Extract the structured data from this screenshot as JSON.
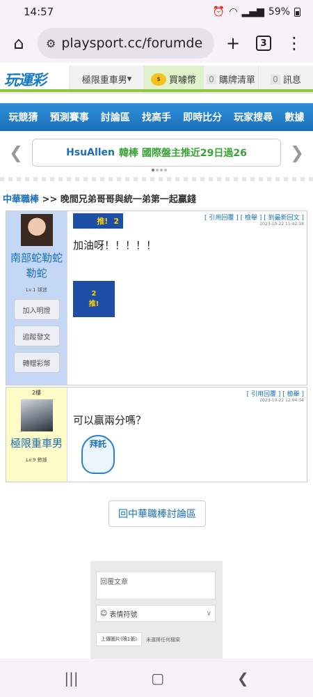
{
  "status": {
    "time": "14:57",
    "battery": "59%"
  },
  "browser": {
    "url": "playsport.cc/forumde",
    "tab_count": "3"
  },
  "site": {
    "logo": "玩運彩",
    "user": "極限重車男",
    "coins_label": "買噱幣",
    "watchlist": {
      "count": "0",
      "label": "購牌清單"
    },
    "messages": {
      "count": "0",
      "label": "訊息"
    }
  },
  "nav": [
    "玩競猜",
    "預測賽事",
    "討論區",
    "找高手",
    "即時比分",
    "玩家搜尋",
    "數據"
  ],
  "marquee": {
    "author": "HsuAllen",
    "text": "韓棒 國際盤主推近29日過26"
  },
  "breadcrumb": {
    "forum": "中華職棒",
    "sep": ">>",
    "title": "晚間兄弟哥哥與統一弟第一起贏錢"
  },
  "posts": [
    {
      "author": "南部蛇勒蛇勒蛇",
      "level": "Lv.1 球迷",
      "buttons": [
        "加入明燈",
        "追蹤發文",
        "轉贈彩幣"
      ],
      "links": "[ 引用回覆 ] [ 檢舉 ] [ 到最新回文 ]",
      "time": "2023-10-22 11:42:18",
      "like_label": "推!",
      "like_count": "2",
      "text": "加油呀！！！！！",
      "sticker_count": "2",
      "sticker_label": "推!"
    },
    {
      "floor": "2樓",
      "author": "極限重車男",
      "level": "Lv.9 數據",
      "links": "[ 引用回覆 ] [ 檢舉 ]",
      "time": "2023-10-22 12:04:34",
      "text": "可以贏兩分嗎？",
      "sticker_text": "拜託"
    }
  ],
  "back_button": "回中華職棒討論區",
  "reply_form": {
    "placeholder": "回覆文章",
    "emoji_label": "表情符號",
    "upload_label": "上傳圖片(限1張)",
    "no_file": "未選擇任何檔案"
  }
}
